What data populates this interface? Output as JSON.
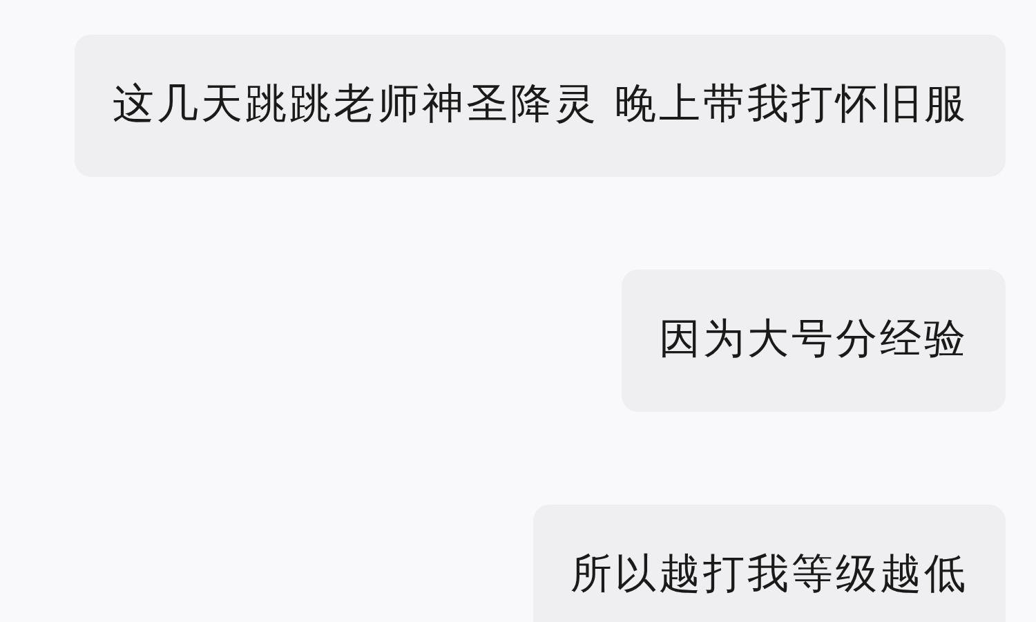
{
  "messages": [
    {
      "text": "这几天跳跳老师神圣降灵 晚上带我打怀旧服"
    },
    {
      "text": "因为大号分经验"
    },
    {
      "text": "所以越打我等级越低"
    }
  ]
}
